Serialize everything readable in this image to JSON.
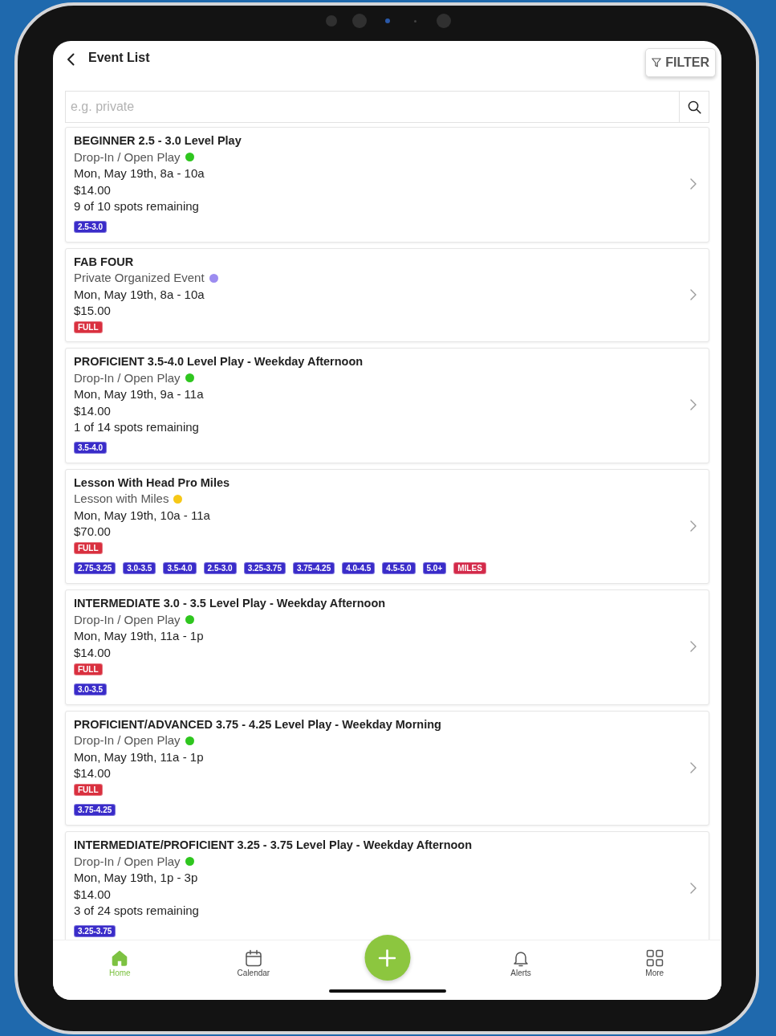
{
  "header": {
    "title": "Event List",
    "filter_label": "FILTER"
  },
  "search": {
    "placeholder": "e.g. private"
  },
  "events": [
    {
      "title": "BEGINNER 2.5 - 3.0 Level Play",
      "category": "Drop-In / Open Play",
      "color": "#2fc61f",
      "when": "Mon, May 19th, 8a - 10a",
      "price": "$14.00",
      "spots": "9 of 10 spots remaining",
      "tags": [
        {
          "label": "2.5-3.0",
          "color": "#3a2cc9"
        }
      ]
    },
    {
      "title": "FAB FOUR",
      "category": "Private Organized Event",
      "color": "#9c8cf0",
      "when": "Mon, May 19th, 8a - 10a",
      "price": "$15.00",
      "status_badge": "FULL"
    },
    {
      "title": "PROFICIENT 3.5-4.0 Level Play - Weekday Afternoon",
      "category": "Drop-In / Open Play",
      "color": "#2fc61f",
      "when": "Mon, May 19th, 9a - 11a",
      "price": "$14.00",
      "spots": "1 of 14 spots remaining",
      "tags": [
        {
          "label": "3.5-4.0",
          "color": "#3a2cc9"
        }
      ]
    },
    {
      "title": "Lesson With Head Pro Miles",
      "category": "Lesson with Miles",
      "color": "#f6c817",
      "when": "Mon, May 19th, 10a - 11a",
      "price": "$70.00",
      "status_badge": "FULL",
      "tags": [
        {
          "label": "2.75-3.25",
          "color": "#3a2cc9"
        },
        {
          "label": "3.0-3.5",
          "color": "#3a2cc9"
        },
        {
          "label": "3.5-4.0",
          "color": "#3a2cc9"
        },
        {
          "label": "2.5-3.0",
          "color": "#3a2cc9"
        },
        {
          "label": "3.25-3.75",
          "color": "#3a2cc9"
        },
        {
          "label": "3.75-4.25",
          "color": "#3a2cc9"
        },
        {
          "label": "4.0-4.5",
          "color": "#3a2cc9"
        },
        {
          "label": "4.5-5.0",
          "color": "#3a2cc9"
        },
        {
          "label": "5.0+",
          "color": "#3a2cc9"
        },
        {
          "label": "MILES",
          "color": "#d32a4a"
        }
      ]
    },
    {
      "title": "INTERMEDIATE 3.0 - 3.5 Level Play - Weekday Afternoon",
      "category": "Drop-In / Open Play",
      "color": "#2fc61f",
      "when": "Mon, May 19th, 11a - 1p",
      "price": "$14.00",
      "status_badge": "FULL",
      "tags": [
        {
          "label": "3.0-3.5",
          "color": "#3a2cc9"
        }
      ]
    },
    {
      "title": "PROFICIENT/ADVANCED 3.75 - 4.25 Level Play - Weekday Morning",
      "category": "Drop-In / Open Play",
      "color": "#2fc61f",
      "when": "Mon, May 19th, 11a - 1p",
      "price": "$14.00",
      "status_badge": "FULL",
      "tags": [
        {
          "label": "3.75-4.25",
          "color": "#3a2cc9"
        }
      ]
    },
    {
      "title": "INTERMEDIATE/PROFICIENT 3.25 - 3.75 Level Play - Weekday Afternoon",
      "category": "Drop-In / Open Play",
      "color": "#2fc61f",
      "when": "Mon, May 19th, 1p - 3p",
      "price": "$14.00",
      "spots": "3 of 24 spots remaining",
      "tags": [
        {
          "label": "3.25-3.75",
          "color": "#3a2cc9"
        }
      ]
    }
  ],
  "nav": [
    {
      "label": "Home",
      "kind": "home",
      "selected": true
    },
    {
      "label": "Calendar",
      "kind": "calendar",
      "selected": false
    },
    {
      "label": "Alerts",
      "kind": "bell",
      "selected": false
    },
    {
      "label": "More",
      "kind": "grid",
      "selected": false
    }
  ]
}
